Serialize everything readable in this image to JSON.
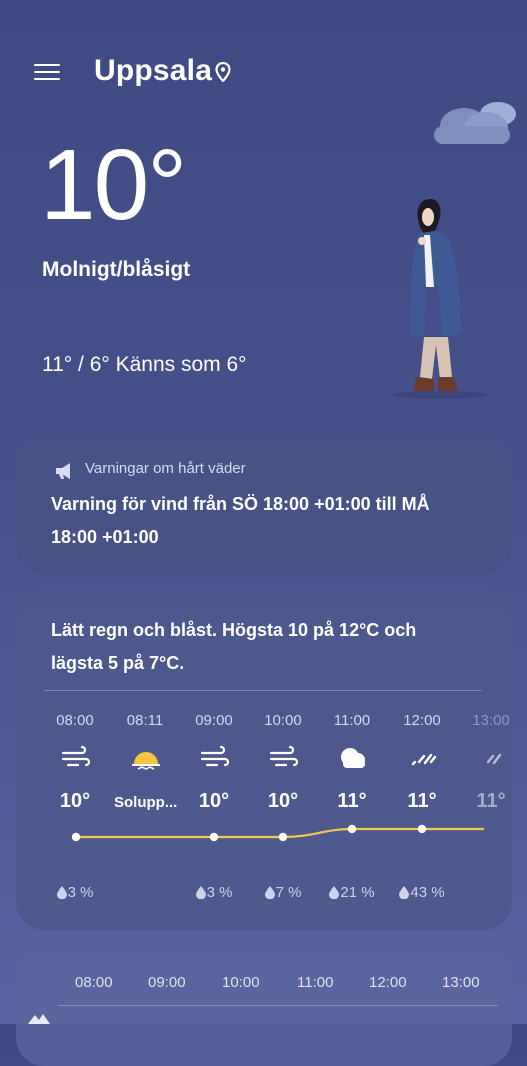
{
  "header": {
    "city": "Uppsala",
    "menu_icon": "hamburger-menu-icon",
    "location_icon": "location-pin-icon"
  },
  "current": {
    "temperature": "10°",
    "condition": "Molnigt/blåsigt",
    "hi_lo_feels": "11° / 6° Känns som 6°"
  },
  "warning": {
    "title": "Varningar om hårt väder",
    "text": "Varning för vind från SÖ 18:00 +01:00 till MÅ 18:00 +01:00",
    "icon": "megaphone-icon"
  },
  "forecast": {
    "summary": "Lätt regn och blåst. Högsta 10 på 12°C och lägsta 5 på 7°C.",
    "hours": [
      {
        "time": "08:00",
        "icon": "wind-icon",
        "temp": "10°",
        "precip": "3 %"
      },
      {
        "time": "08:11",
        "icon": "sunrise-icon",
        "temp": "Solupp...",
        "precip": ""
      },
      {
        "time": "09:00",
        "icon": "wind-icon",
        "temp": "10°",
        "precip": "3 %"
      },
      {
        "time": "10:00",
        "icon": "wind-icon",
        "temp": "10°",
        "precip": "7 %"
      },
      {
        "time": "11:00",
        "icon": "cloudy-icon",
        "temp": "11°",
        "precip": "21 %"
      },
      {
        "time": "12:00",
        "icon": "drizzle-icon",
        "temp": "11°",
        "precip": "43 %"
      },
      {
        "time": "13:00",
        "icon": "drizzle-icon",
        "temp": "11°",
        "precip": ""
      }
    ]
  },
  "second_card": {
    "times": [
      "08:00",
      "09:00",
      "10:00",
      "11:00",
      "12:00",
      "13:00"
    ]
  },
  "colors": {
    "background": "#434d86",
    "card": "#485284",
    "temp_line": "#f2c94c"
  }
}
